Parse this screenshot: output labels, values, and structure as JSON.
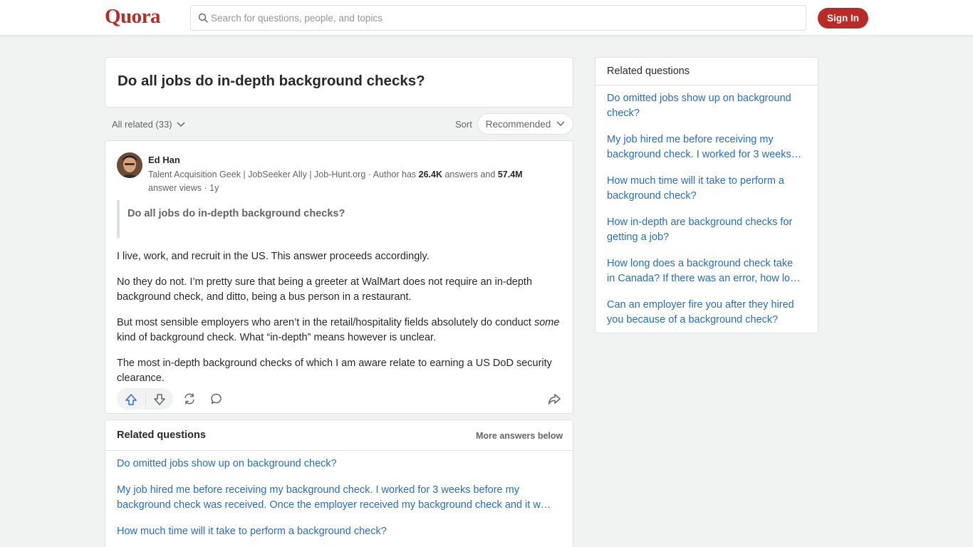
{
  "header": {
    "logo": "Quora",
    "search_placeholder": "Search for questions, people, and topics",
    "signin_label": "Sign In"
  },
  "question": {
    "title": "Do all jobs do in-depth background checks?"
  },
  "filter": {
    "all_related": "All related (33)",
    "sort_label": "Sort",
    "sort_value": "Recommended"
  },
  "answer": {
    "author": "Ed Han",
    "cred_prefix": "Talent Acquisition Geek | JobSeeker Ally | Job-Hunt.org · Author has ",
    "answers_count": "26.4K",
    "cred_mid": " answers and ",
    "views_count": "57.4M",
    "cred_suffix": " answer views · 1y",
    "quoted_question": "Do all jobs do in-depth background checks?",
    "p1": "I live, work, and recruit in the US. This answer proceeds accordingly.",
    "p2": "No they do not. I’m pretty sure that being a greeter at WalMart does not require an in-depth background check, and ditto, being a bus person in a restaurant.",
    "p3_start": "But most sensible employers who aren’t in the retail/hospitality fields absolutely do conduct ",
    "p3_em": "some",
    "p3_end": " kind of background check. What “in-depth” means however is unclear.",
    "p4": "The most in-depth background checks of which I am aware relate to earning a US DoD security clearance."
  },
  "related_main": {
    "heading": "Related questions",
    "more": "More answers below",
    "links": [
      "Do omitted jobs show up on background check?",
      "My job hired me before receiving my background check. I worked for 3 weeks before my background check was received. Once the employer received my background check and it w…",
      "How much time will it take to perform a background check?"
    ]
  },
  "sidebar": {
    "heading": "Related questions",
    "links": [
      [
        "Do omitted jobs show up on background",
        "check?"
      ],
      [
        "My job hired me before receiving my",
        "background check. I worked for 3 weeks…"
      ],
      [
        "How much time will it take to perform a",
        "background check?"
      ],
      [
        "How in-depth are background checks for",
        "getting a job?"
      ],
      [
        "How long does a background check take",
        "in Canada? If there was an error, how lo…"
      ],
      [
        "Can an employer fire you after they hired",
        "you because of a background check?"
      ]
    ]
  },
  "colors": {
    "brand": "#b92b27",
    "link": "#2b6dad",
    "upvote": "#2e69ff"
  }
}
